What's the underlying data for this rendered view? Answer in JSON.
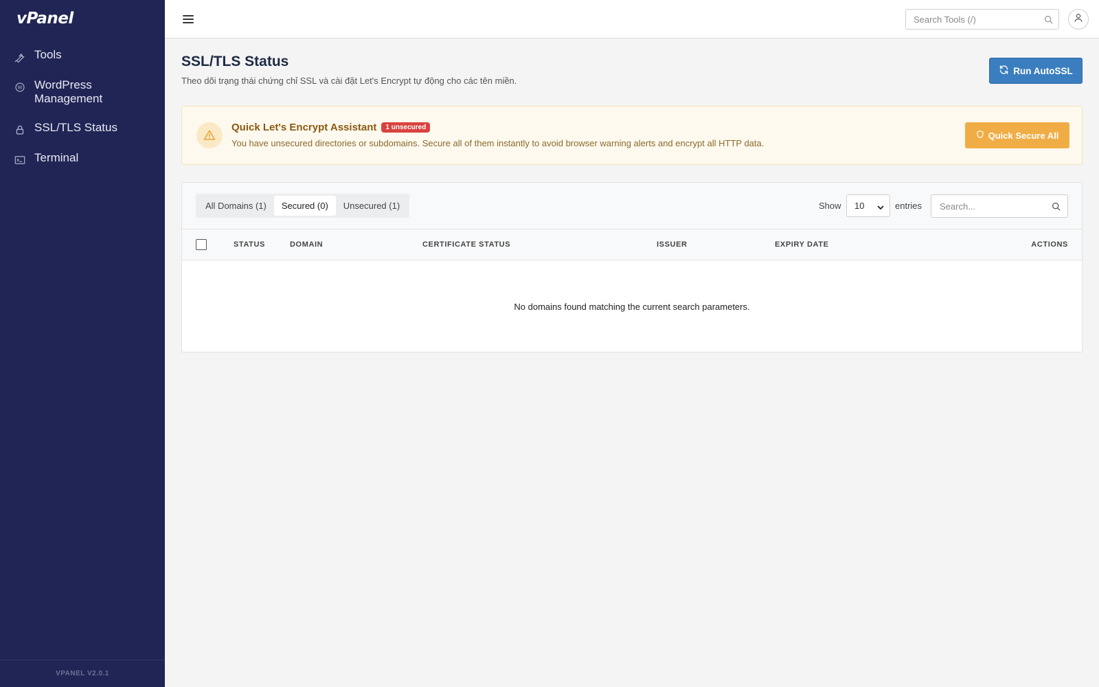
{
  "app": {
    "logo": "vPanel",
    "version": "VPANEL V2.0.1"
  },
  "sidebar": {
    "items": [
      {
        "label": "Tools",
        "icon": "wrench-icon"
      },
      {
        "label": "WordPress Management",
        "icon": "wordpress-icon"
      },
      {
        "label": "SSL/TLS Status",
        "icon": "lock-icon"
      },
      {
        "label": "Terminal",
        "icon": "terminal-icon"
      }
    ]
  },
  "topbar": {
    "search_placeholder": "Search Tools (/)",
    "menu_icon": "hamburger-icon",
    "user_icon": "user-icon"
  },
  "page": {
    "title": "SSL/TLS Status",
    "description": "Theo dõi trạng thái chứng chỉ SSL và cài đặt Let's Encrypt tự động cho các tên miền.",
    "run_autossl_label": "Run AutoSSL"
  },
  "alert": {
    "title": "Quick Let's Encrypt Assistant",
    "badge": "1 unsecured",
    "text": "You have unsecured directories or subdomains. Secure all of them instantly to avoid browser warning alerts and encrypt all HTTP data.",
    "button_label": "Quick Secure All",
    "icon": "warning-triangle-icon"
  },
  "table": {
    "tabs": [
      {
        "label": "All Domains (1)",
        "active": false
      },
      {
        "label": "Secured (0)",
        "active": true
      },
      {
        "label": "Unsecured (1)",
        "active": false
      }
    ],
    "show_label": "Show",
    "entries_value": "10",
    "entries_label": "entries",
    "search_placeholder": "Search...",
    "columns": [
      "STATUS",
      "DOMAIN",
      "CERTIFICATE STATUS",
      "ISSUER",
      "EXPIRY DATE",
      "ACTIONS"
    ],
    "empty_message": "No domains found matching the current search parameters."
  },
  "colors": {
    "sidebar_bg": "#212555",
    "primary_button": "#3a7ebf",
    "warning_button": "#f0ad45",
    "badge_red": "#d9423e",
    "alert_bg": "#fef9ee"
  }
}
